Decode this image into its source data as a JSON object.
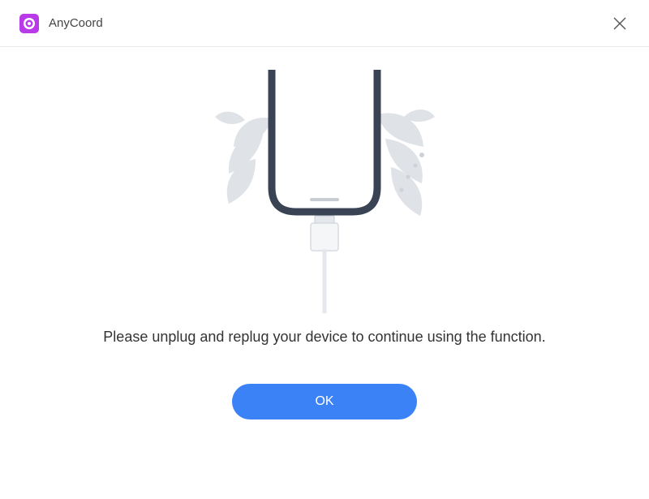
{
  "app": {
    "title": "AnyCoord"
  },
  "dialog": {
    "message": "Please unplug and replug your device to continue using the function.",
    "ok_label": "OK"
  }
}
